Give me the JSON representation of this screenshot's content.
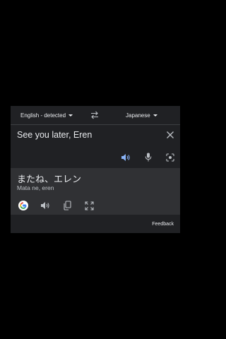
{
  "lang_bar": {
    "source_lang": "English - detected",
    "target_lang": "Japanese"
  },
  "input": {
    "text": "See you later, Eren"
  },
  "output": {
    "translation": "またね、エレン",
    "romanization": "Mata ne, eren"
  },
  "footer": {
    "feedback_label": "Feedback"
  },
  "icons": {
    "swap": "swap-icon",
    "clear": "close-icon",
    "speaker_input": "speaker-icon",
    "mic": "microphone-icon",
    "camera": "camera-icon",
    "google": "google-logo-icon",
    "speaker_output": "speaker-icon",
    "copy": "copy-icon",
    "fullscreen": "fullscreen-icon"
  },
  "colors": {
    "accent": "#8ab4f8",
    "card_bg": "#202124",
    "output_bg": "#303134"
  }
}
